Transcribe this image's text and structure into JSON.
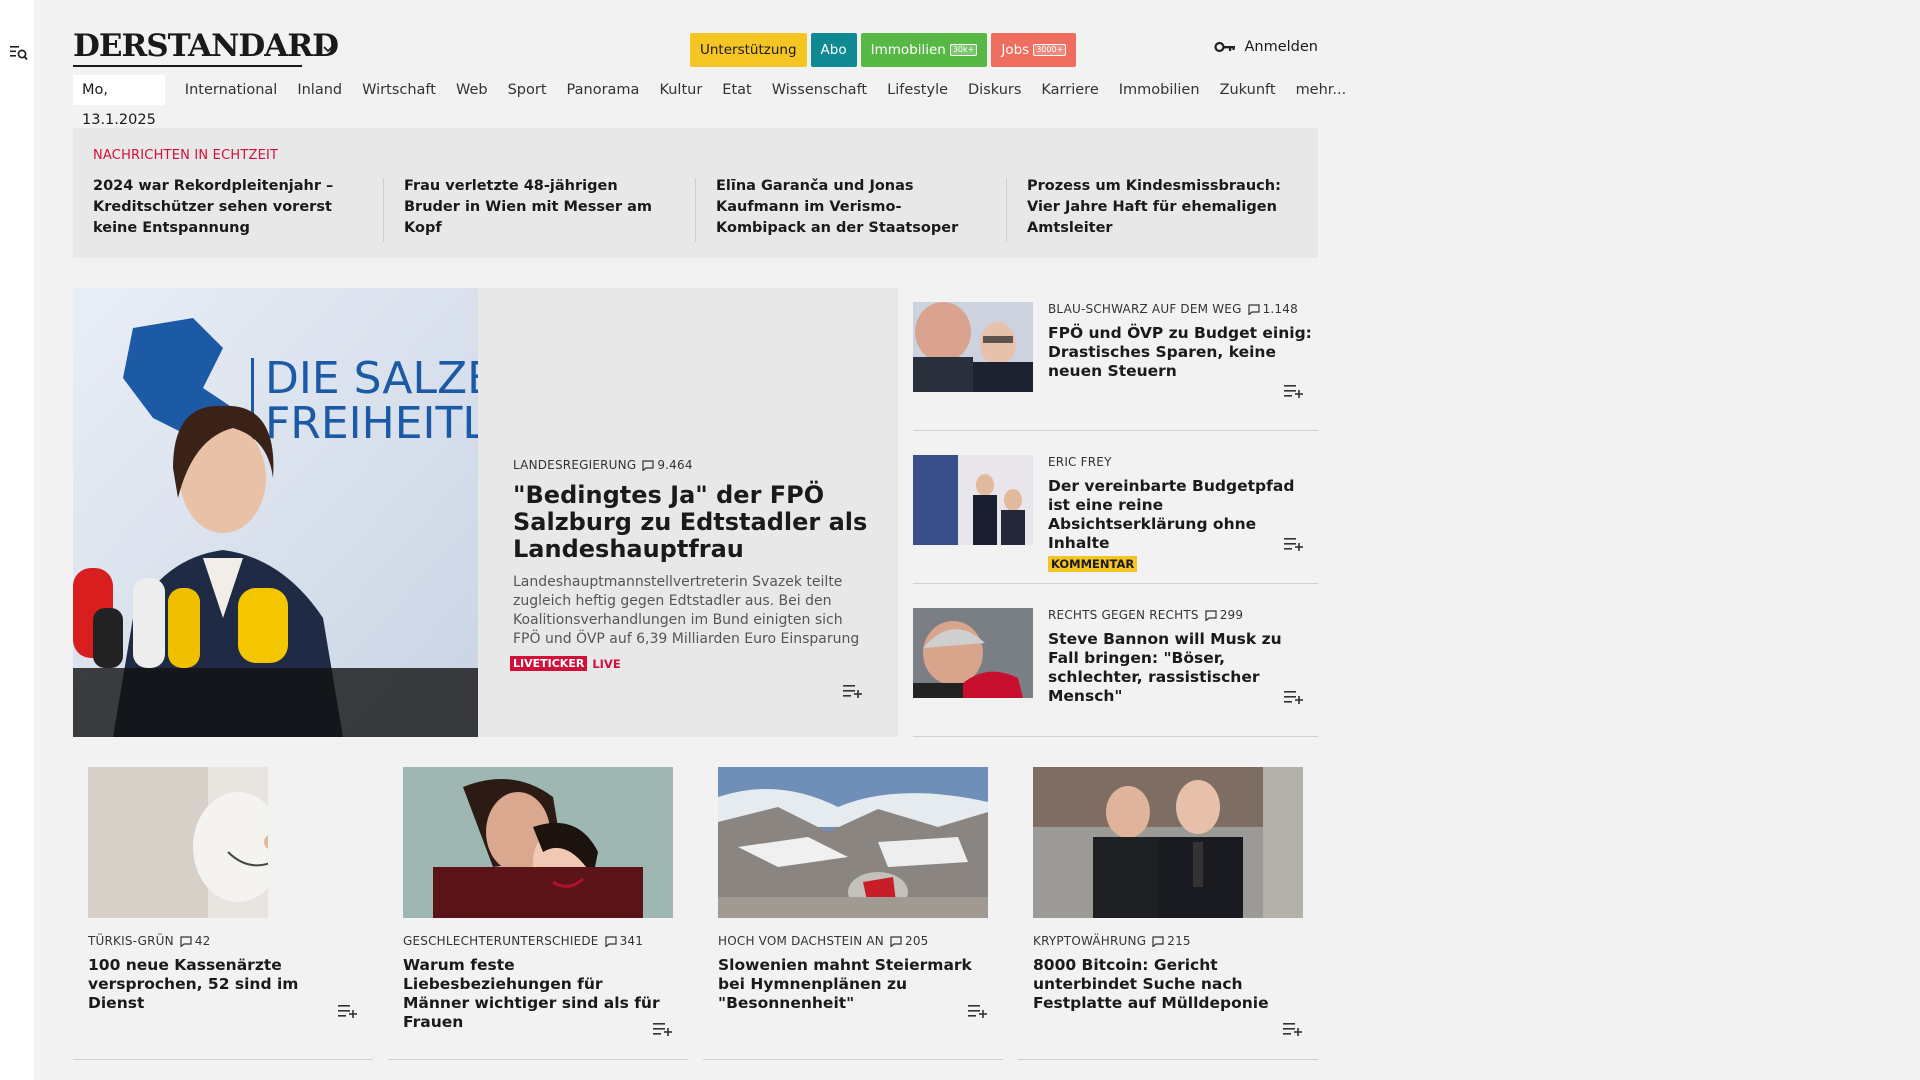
{
  "brand": {
    "logo_text": "DERSTANDARD"
  },
  "header": {
    "buttons": [
      {
        "label": "Unterstützung"
      },
      {
        "label": "Abo"
      },
      {
        "label": "Immobilien",
        "badge": "30k+"
      },
      {
        "label": "Jobs",
        "badge": "3000+"
      }
    ],
    "login_label": "Anmelden"
  },
  "nav": {
    "date": "Mo, 13.1.2025",
    "items": [
      "International",
      "Inland",
      "Wirtschaft",
      "Web",
      "Sport",
      "Panorama",
      "Kultur",
      "Etat",
      "Wissenschaft",
      "Lifestyle",
      "Diskurs",
      "Karriere",
      "Immobilien",
      "Zukunft",
      "mehr..."
    ]
  },
  "ticker": {
    "label": "NACHRICHTEN IN ECHTZEIT",
    "items": [
      "2024 war Rekordpleitenjahr – Kredit­schützer sehen vorerst keine Entspannung",
      "Frau verletzte 48-jährigen Bruder in Wien mit Messer am Kopf",
      "Elīna Garanča und Jonas Kaufmann im Verismo-Kombipack an der Staatsoper",
      "Prozess um Kindesmissbrauch: Vier Jahre Haft für ehemaligen Amtsleiter"
    ]
  },
  "hero": {
    "image_text_1": "DIE SALZB",
    "image_text_2": "FREIHEITL",
    "kicker": "LANDESREGIERUNG",
    "comments": "9.464",
    "title": "\"Bedingtes Ja\" der FPÖ Salzburg zu Edtstadler als Lan­deshauptfrau",
    "description": "Landeshauptmannstellvertreterin Svazek teilte zugleich heftig gegen Edtstadler aus. Bei den Koali­tionsverhandlungen im Bund einigten sich FPÖ und ÖVP auf 6,39 Milliarden Euro Einsparung",
    "liveticker": "LIVETICKER",
    "live": "LIVE"
  },
  "side": [
    {
      "kicker": "BLAU-SCHWARZ AUF DEM WEG",
      "comments": "1.148",
      "title": "FPÖ und ÖVP zu Budget einig: Drastisches Sparen, keine neuen Steuern"
    },
    {
      "kicker": "ERIC FREY",
      "comments": "",
      "title": "Der vereinbarte Budgetpfad ist eine reine Absichtserklärung ohne Inhalte",
      "tag": "KOMMENTAR"
    },
    {
      "kicker": "RECHTS GEGEN RECHTS",
      "comments": "299",
      "title": "Steve Bannon will Musk zu Fall bringen: \"Böser, schlechter, rassistischer Mensch\""
    }
  ],
  "cards": [
    {
      "kicker": "TÜRKIS-GRÜN",
      "comments": "42",
      "title": "100 neue Kassenärzte versprochen, 52 sind im Dienst"
    },
    {
      "kicker": "GESCHLECHTERUNTERSCHIEDE",
      "comments": "341",
      "title": "Warum feste Liebesbeziehungen für Männer wichtiger sind als für Frauen"
    },
    {
      "kicker": "HOCH VOM DACHSTEIN AN",
      "comments": "205",
      "title": "Slowenien mahnt Steiermark bei Hymnenplänen zu \"Besonnenheit\""
    },
    {
      "kicker": "KRYPTOWÄHRUNG",
      "comments": "215",
      "title": "8000 Bitcoin: Gericht unterbindet Suche nach Festplatte auf Mülldeponie"
    }
  ],
  "colors": {
    "accent_red": "#d0103a",
    "yellow": "#f5c623",
    "teal": "#0f8a92",
    "green": "#58b846",
    "coral": "#ef6d5e"
  },
  "icons": [
    "menu-search-icon",
    "chevron-down-icon",
    "key-icon",
    "comment-icon",
    "add-to-list-icon"
  ]
}
